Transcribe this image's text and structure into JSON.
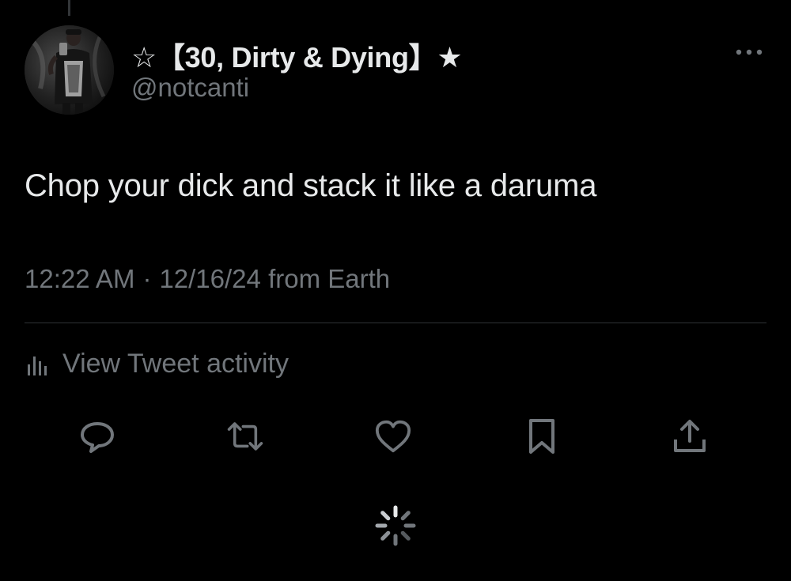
{
  "author": {
    "display_name": "☆【30, Dirty & Dying】★",
    "handle": "@notcanti"
  },
  "tweet": {
    "text": "Chop your dick and stack it like a daruma",
    "time": "12:22 AM",
    "separator": "·",
    "date": "12/16/24",
    "source": "from Earth"
  },
  "activity": {
    "label": "View Tweet activity"
  },
  "actions": {
    "icons": [
      "reply-icon",
      "retweet-icon",
      "like-icon",
      "bookmark-icon",
      "share-icon"
    ]
  },
  "colors": {
    "background": "#000000",
    "primary_text": "#e7e9ea",
    "secondary_text": "#71767b",
    "divider": "#2f3336"
  }
}
